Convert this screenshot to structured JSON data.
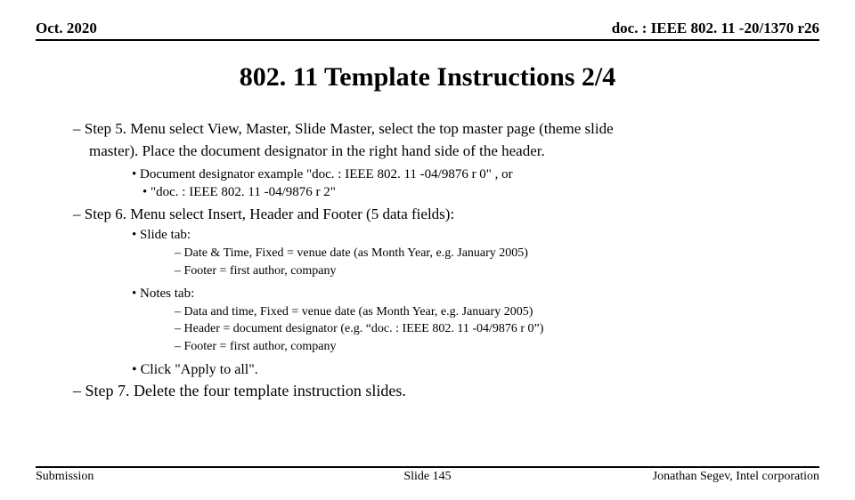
{
  "header": {
    "left": "Oct. 2020",
    "right": "doc. : IEEE 802. 11 -20/1370 r26"
  },
  "title": "802. 11 Template Instructions 2/4",
  "content": {
    "step5a": "– Step 5. Menu select View, Master, Slide Master, select the top master page (theme slide",
    "step5b": "master).  Place the document designator in the right hand side of the header.",
    "step5_bullet1": "• Document designator example \"doc. : IEEE 802. 11 -04/9876 r 0\"       , or",
    "step5_bullet2": "•                                                  \"doc. : IEEE 802. 11 -04/9876 r 2\"",
    "step6": "– Step 6. Menu select Insert, Header and Footer (5 data fields):",
    "slide_tab": "• Slide tab:",
    "slide_sub1": "– Date & Time, Fixed =  venue date (as Month Year, e.g. January 2005)",
    "slide_sub2": "– Footer = first author, company",
    "notes_tab": "• Notes tab:",
    "notes_sub1": "– Data and time, Fixed = venue date (as Month Year, e.g. January 2005)",
    "notes_sub2": "– Header = document designator (e.g. “doc. : IEEE 802. 11 -04/9876 r 0”)",
    "notes_sub3": "– Footer = first author, company",
    "apply": "• Click \"Apply to all\".",
    "step7": "–  Step 7. Delete the four template instruction slides."
  },
  "footer": {
    "left": "Submission",
    "center": "Slide 145",
    "right": "Jonathan Segev, Intel corporation"
  }
}
